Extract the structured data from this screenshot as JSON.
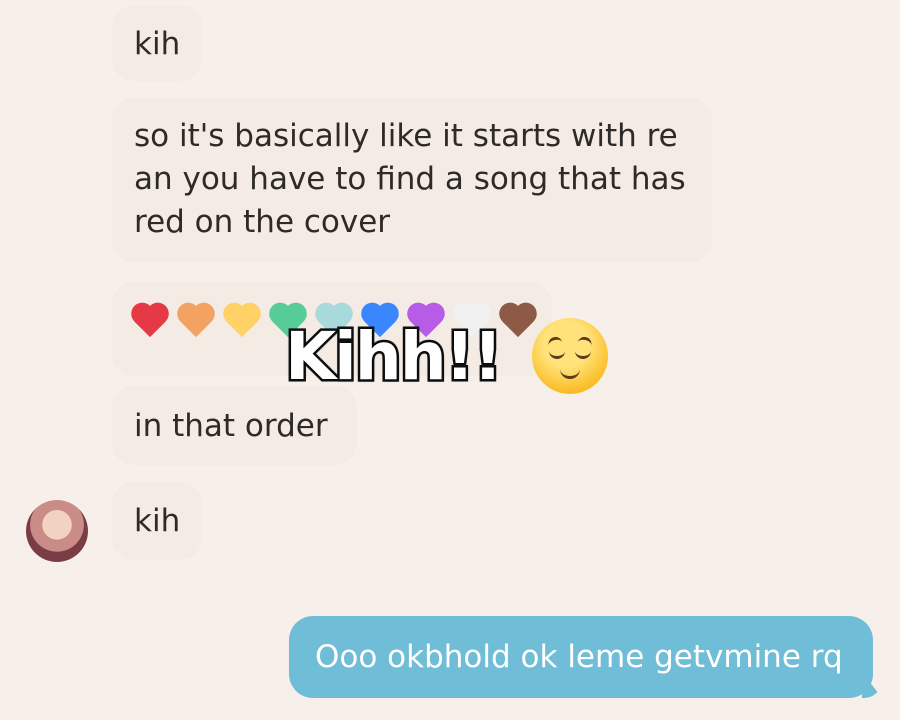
{
  "messages": [
    {
      "text": "kih"
    },
    {
      "text": "so it's basically like it starts with re an you have to find a song that has red on the cover"
    },
    {
      "hearts": [
        "#e63946",
        "#f4a261",
        "#ffd166",
        "#57cc99",
        "#a8dadc",
        "#3a86ff",
        "#b65ce6",
        "#f1f1f1",
        "#8d5a47"
      ]
    },
    {
      "text": "in that order"
    },
    {
      "text": "kih"
    }
  ],
  "outgoing": {
    "text": "Ooo okbhold ok leme getvmine rq"
  },
  "overlay": {
    "text": "Kihh!!",
    "emoji": "relieved-face-emoji"
  },
  "colors": {
    "background": "#f7f0ea",
    "incoming_bubble": "#f3ebe4",
    "outgoing_bubble": "#6fbdd6"
  }
}
